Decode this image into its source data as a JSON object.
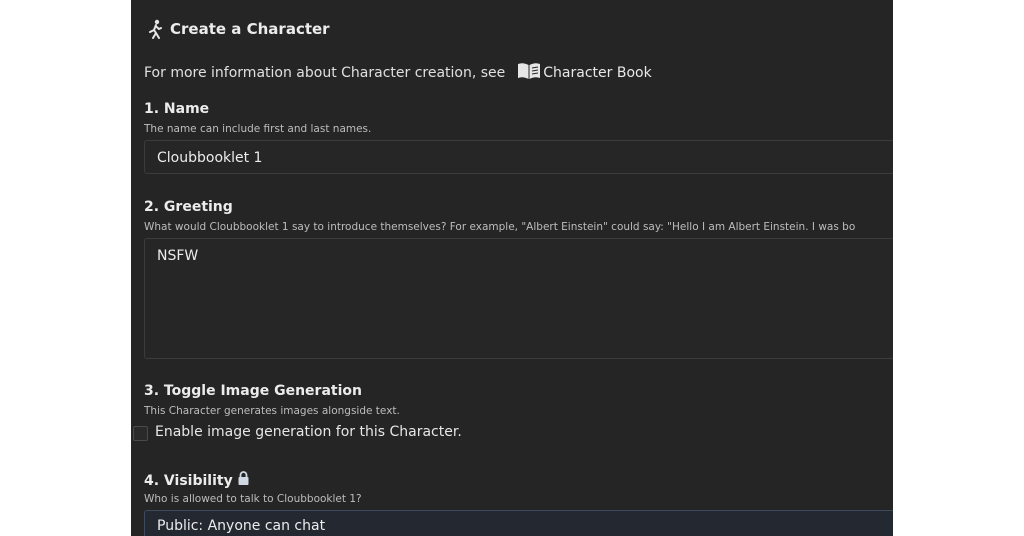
{
  "header": {
    "title": "Create a Character",
    "title_icon": "walking-person-icon"
  },
  "info": {
    "text": "For more information about Character creation, see",
    "link_label": "Character Book",
    "link_icon": "book-icon"
  },
  "sections": {
    "name": {
      "title": "1. Name",
      "hint": "The name can include first and last names.",
      "value": "Cloubbooklet 1"
    },
    "greeting": {
      "title": "2. Greeting",
      "hint": "What would Cloubbooklet 1 say to introduce themselves? For example, \"Albert Einstein\" could say: \"Hello I am Albert Einstein. I was bo",
      "value": "NSFW"
    },
    "image_generation": {
      "title": "3. Toggle Image Generation",
      "hint": "This Character generates images alongside text.",
      "checkbox_label": "Enable image generation for this Character.",
      "checked": false
    },
    "visibility": {
      "title": "4. Visibility",
      "title_icon": "lock-icon",
      "hint": "Who is allowed to talk to Cloubbooklet 1?",
      "value": "Public: Anyone can chat"
    }
  },
  "colors": {
    "panel_bg": "#252525",
    "page_bg": "#ffffff",
    "text": "#ececec",
    "hint_text": "#bdbdbd",
    "field_border": "#3c3c3c"
  }
}
